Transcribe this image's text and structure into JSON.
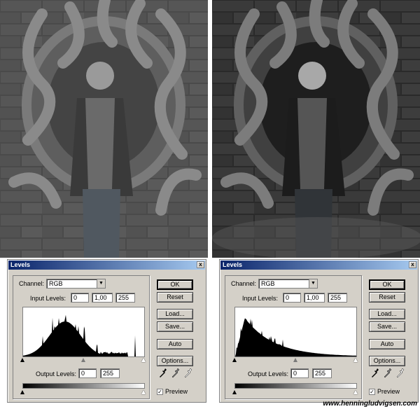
{
  "photos": {
    "left": {
      "tone": "flat"
    },
    "right": {
      "tone": "contrast"
    }
  },
  "dialogs": [
    {
      "title": "Levels",
      "close_glyph": "x",
      "channel_label": "Channel:",
      "channel_value": "RGB",
      "input_levels_label": "Input Levels:",
      "input_black": "0",
      "input_gamma": "1,00",
      "input_white": "255",
      "output_levels_label": "Output Levels:",
      "output_black": "0",
      "output_white": "255",
      "buttons": {
        "ok": "OK",
        "reset": "Reset",
        "load": "Load...",
        "save": "Save...",
        "auto": "Auto",
        "options": "Options..."
      },
      "preview_label": "Preview",
      "preview_checked": true,
      "histogram": "mid-spiky"
    },
    {
      "title": "Levels",
      "close_glyph": "x",
      "channel_label": "Channel:",
      "channel_value": "RGB",
      "input_levels_label": "Input Levels:",
      "input_black": "0",
      "input_gamma": "1,00",
      "input_white": "255",
      "output_levels_label": "Output Levels:",
      "output_black": "0",
      "output_white": "255",
      "buttons": {
        "ok": "OK",
        "reset": "Reset",
        "load": "Load...",
        "save": "Save...",
        "auto": "Auto",
        "options": "Options..."
      },
      "preview_label": "Preview",
      "preview_checked": true,
      "histogram": "left-skewed"
    }
  ],
  "watermark": "www.henningludvigsen.com",
  "icons": [
    "eyedropper-black-icon",
    "eyedropper-gray-icon",
    "eyedropper-white-icon",
    "close-icon",
    "checkmark-icon"
  ]
}
